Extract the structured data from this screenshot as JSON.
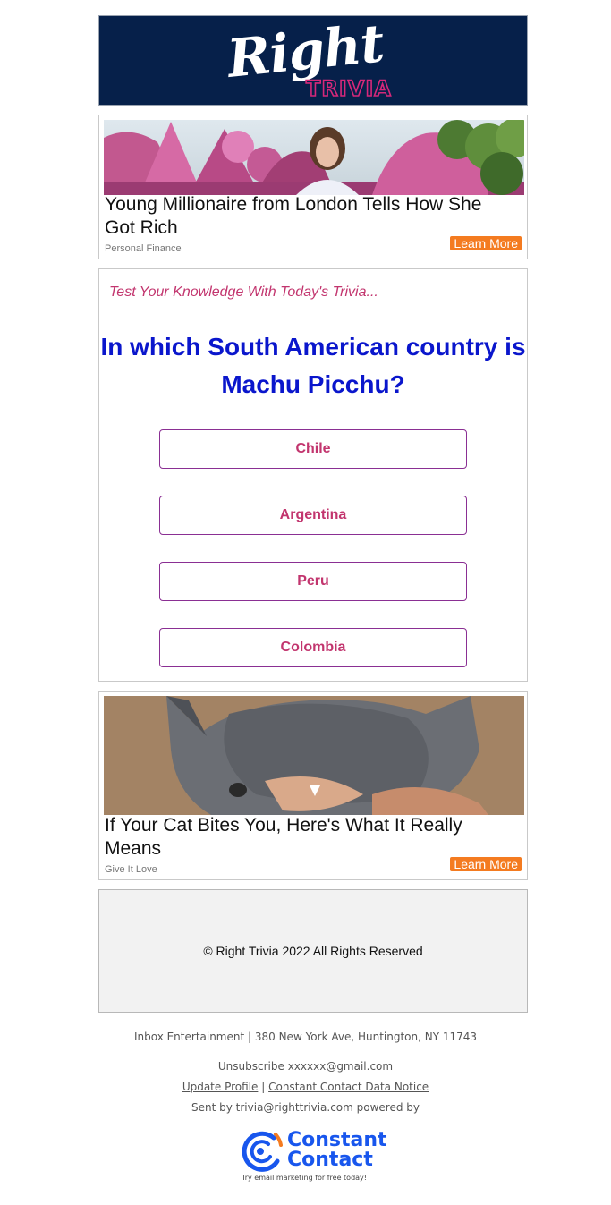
{
  "header": {
    "logo_word": "Right",
    "logo_sub": "TRIVIA"
  },
  "ad1": {
    "title": "Young Millionaire from London Tells How She Got Rich",
    "source": "Personal Finance",
    "cta": "Learn More"
  },
  "trivia": {
    "intro": "Test Your Knowledge With Today's Trivia...",
    "question": "In which South American country is Machu Picchu?",
    "answers": [
      "Chile",
      "Argentina",
      "Peru",
      "Colombia"
    ]
  },
  "ad2": {
    "title": "If Your Cat Bites You, Here's What It Really Means",
    "source": "Give It Love",
    "cta": "Learn More"
  },
  "footer": {
    "copyright": "© Right Trivia 2022 All Rights Reserved",
    "address": "Inbox Entertainment | 380 New York Ave, Huntington, NY 11743",
    "unsubscribe_label": "Unsubscribe",
    "email": "xxxxxx@gmail.com",
    "update_profile": "Update Profile",
    "separator": "|",
    "data_notice": "Constant Contact Data Notice",
    "sent_by": "Sent by trivia@righttrivia.com powered by",
    "cc_line1": "Constant",
    "cc_line2": "Contact",
    "cc_tagline": "Try email marketing for free today!"
  },
  "colors": {
    "header_bg": "#06204a",
    "brand_pink": "#d6287a",
    "question_blue": "#0a16cc",
    "answer_text": "#c2356e",
    "answer_border": "#8a2f93",
    "cta_orange": "#f47b20",
    "cc_blue": "#1856ed"
  }
}
